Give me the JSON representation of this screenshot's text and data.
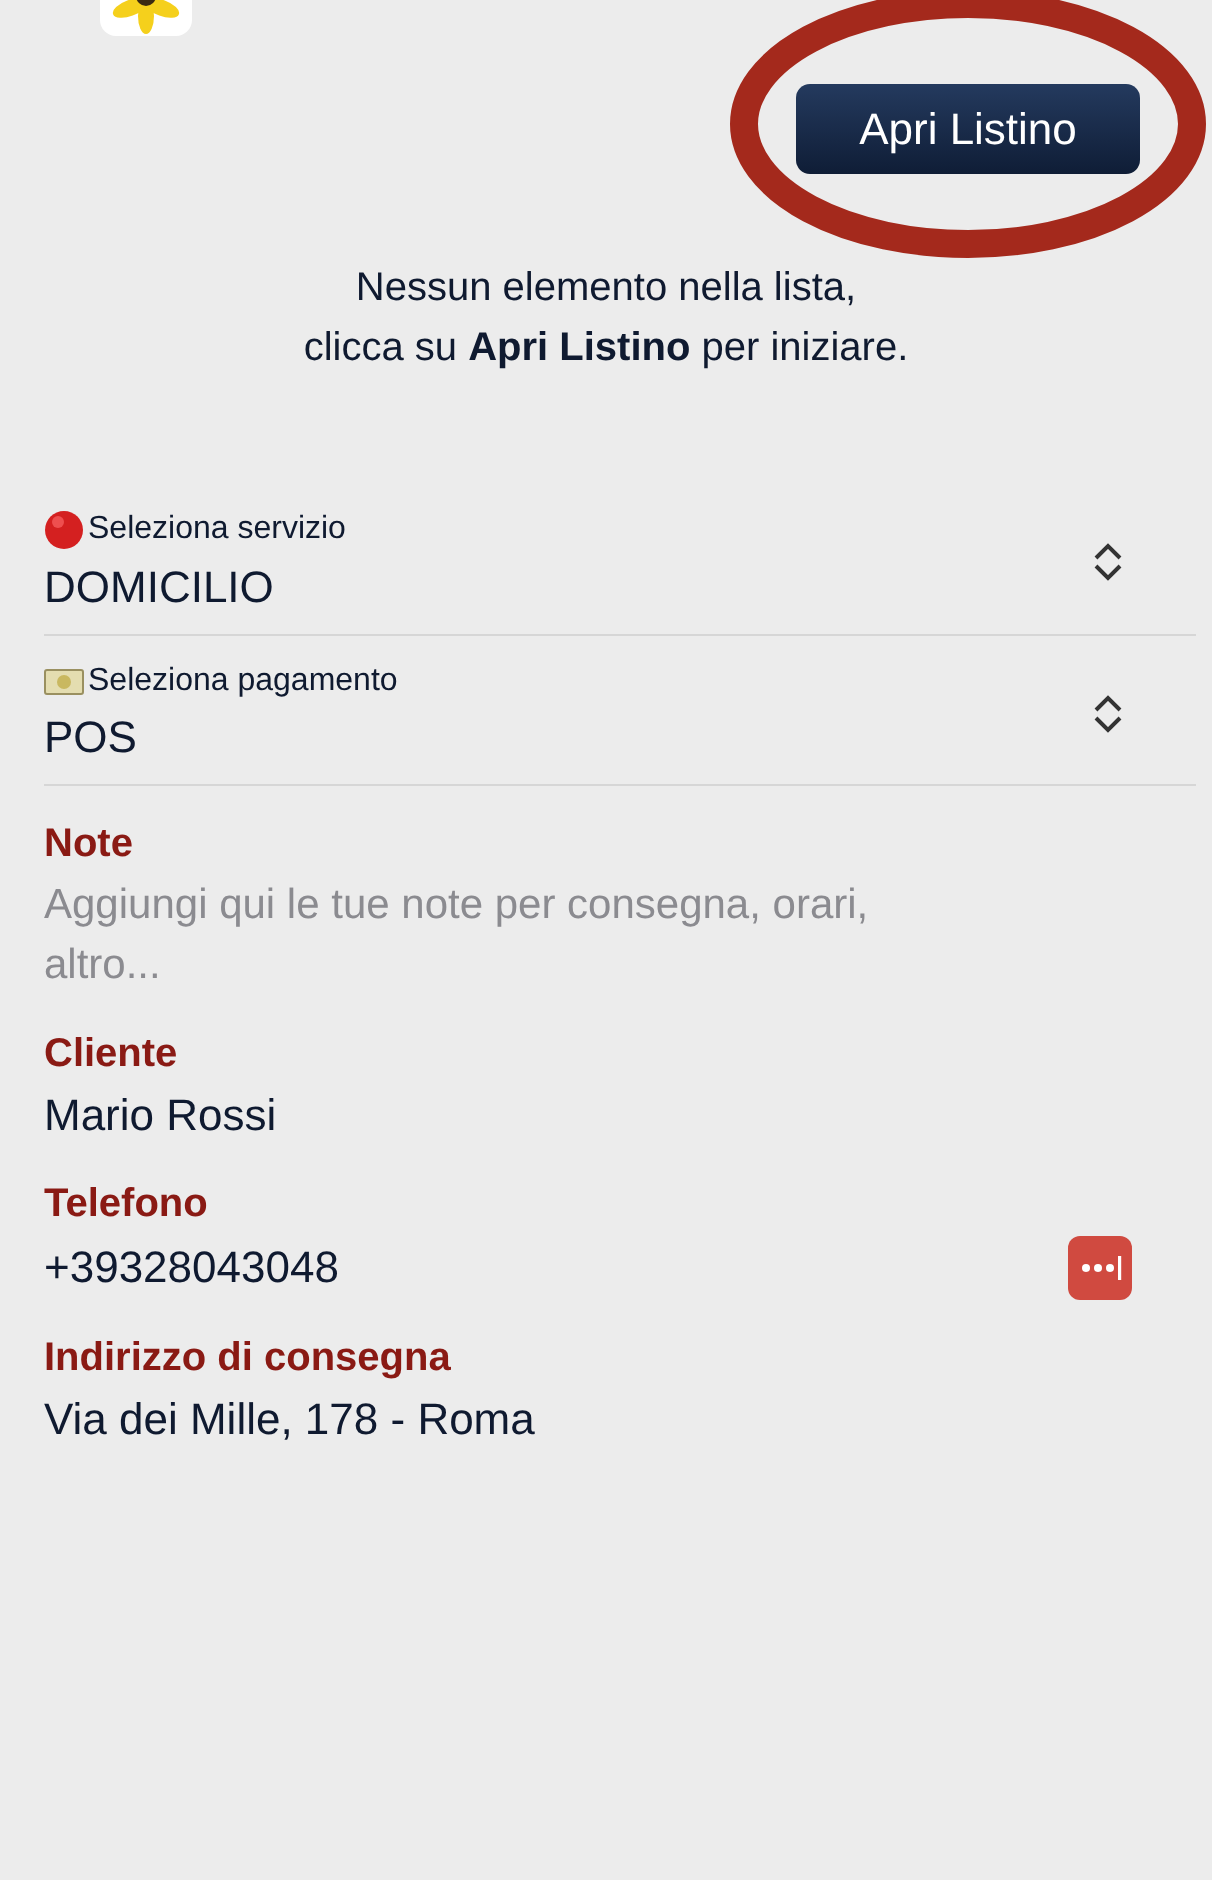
{
  "open_list_button": {
    "label": "Apri Listino",
    "highlighted": true
  },
  "empty_message": {
    "lines": [
      "Nessun elemento nella lista,",
      "clicca su **Apri Listino** per iniziare."
    ]
  },
  "pickers": [
    {
      "kind": "service",
      "label": "Seleziona servizio",
      "value": "DOMICILIO"
    },
    {
      "kind": "payment",
      "label": "Seleziona pagamento",
      "value": "POS"
    }
  ],
  "fields": [
    {
      "label": "Note",
      "placeholder": "Aggiungi qui le tue note per consegna, orari, altro..."
    },
    {
      "label": "Cliente",
      "value": "Mario Rossi"
    },
    {
      "label": "Telefono",
      "value": "+39328043048",
      "password_manager": true
    },
    {
      "label": "Indirizzo di consegna",
      "value": "Via dei Mille, 178 - Roma"
    }
  ]
}
